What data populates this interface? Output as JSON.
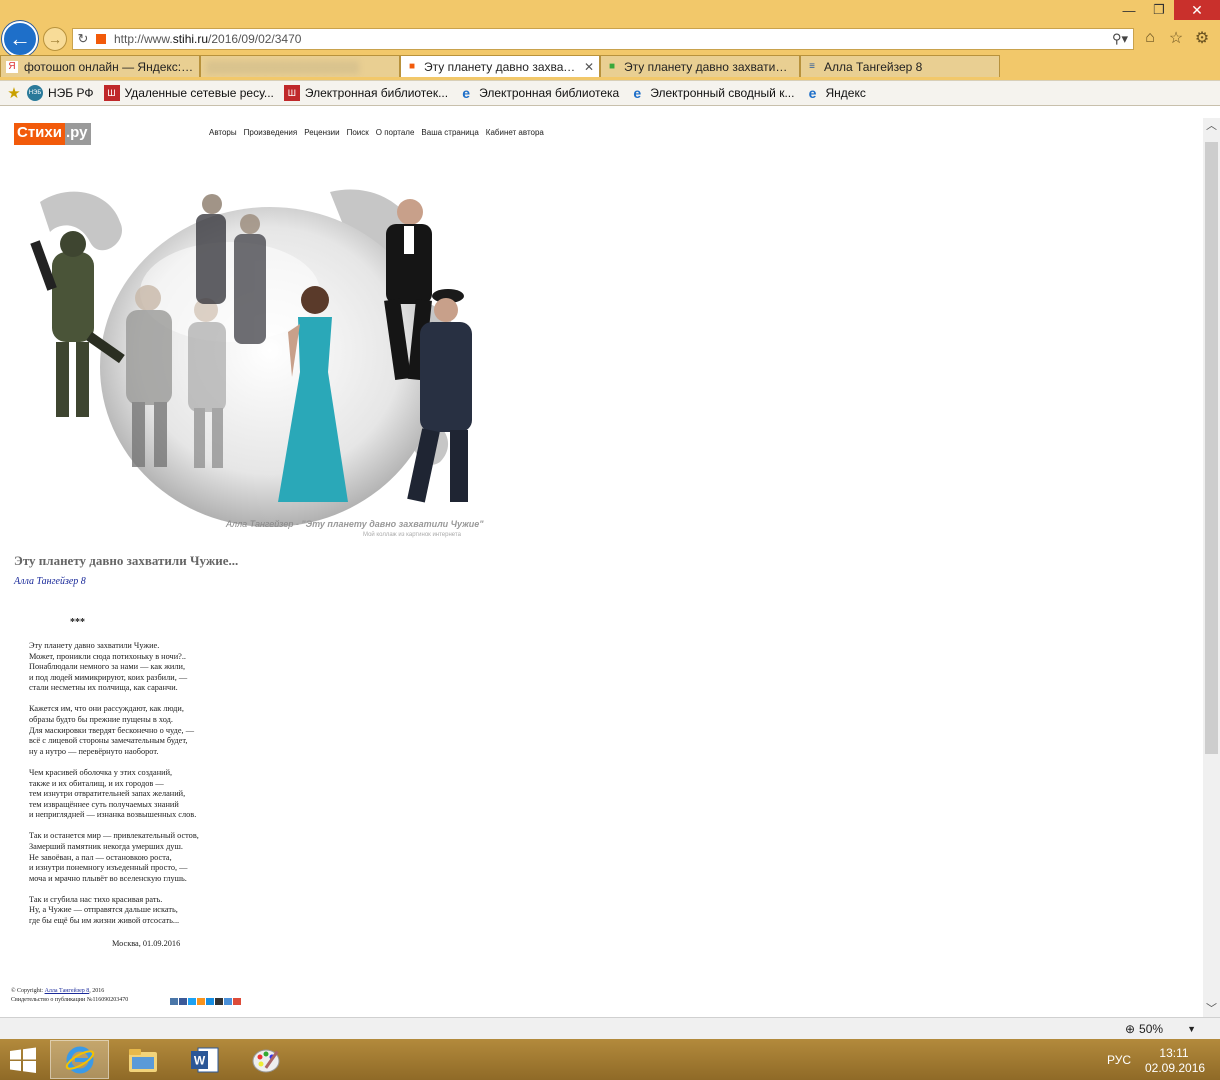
{
  "browser": {
    "window_controls": {
      "minimize": "—",
      "restore": "❐",
      "close": "✕"
    },
    "url_prefix": "http://www.",
    "url_domain": "stihi.ru",
    "url_path": "/2016/09/02/3470",
    "tabs": [
      {
        "label": "фотошоп онлайн — Яндекс: ...",
        "favicon": "Я",
        "favicon_color": "#d33"
      },
      {
        "label": "",
        "favicon": "",
        "blurred": true
      },
      {
        "label": "Эту планету давно захвати...",
        "favicon": "■",
        "favicon_color": "#f25a0a",
        "active": true,
        "close": "✕"
      },
      {
        "label": "Эту планету давно захватили.....",
        "favicon": "■",
        "favicon_color": "#3aa83a"
      },
      {
        "label": "Алла Тангейзер 8",
        "favicon": "≡",
        "favicon_color": "#2a5a9a"
      }
    ],
    "favorites": [
      {
        "label": "НЭБ РФ",
        "icon": "нэб"
      },
      {
        "label": "Удаленные сетевые ресу...",
        "icon": "Ш"
      },
      {
        "label": "Электронная библиотек...",
        "icon": "Ш"
      },
      {
        "label": "Электронная библиотека",
        "icon": "e"
      },
      {
        "label": "Электронный сводный к...",
        "icon": "e"
      },
      {
        "label": "Яндекс",
        "icon": "e"
      }
    ],
    "zoom": "50%"
  },
  "site": {
    "logo_part1": "Стихи",
    "logo_part2": ".ру",
    "nav": [
      "Авторы",
      "Произведения",
      "Рецензии",
      "Поиск",
      "О портале",
      "Ваша страница",
      "Кабинет автора"
    ]
  },
  "hero": {
    "caption_author": "Алла Тангейзер - ",
    "caption_title": "\"Эту планету давно захватили Чужие\"",
    "subcaption": "Мой коллаж из картинок интернета"
  },
  "poem": {
    "title": "Эту планету давно захватили Чужие...",
    "author": "Алла Тангейзер 8",
    "stars": "***",
    "stanzas": [
      [
        "Эту планету давно захватили Чужие.",
        "Может, проникли сюда потихоньку в ночи?..",
        "Понаблюдали немного за нами — как жили,",
        "и под людей мимикрируют, коих разбили, —",
        "стали несметны их полчища, как саранчи."
      ],
      [
        "Кажется им, что они рассуждают, как люди,",
        "образы будто бы прежние пущены в ход.",
        "Для маскировки твердят бесконечно о чуде, —",
        "всё с лицевой стороны замечательным будет,",
        "ну а нутро — перевёрнуто наоборот."
      ],
      [
        "Чем красивей оболочка у этих созданий,",
        "также и их обиталищ, и их городов —",
        "тем изнутри отвратительней запах желаний,",
        "тем извращённее суть получаемых знаний",
        " и неприглядней — изнанка возвышенных слов."
      ],
      [
        "Так и останется мир — привлекательный остов,",
        "Замерший памятник некогда умерших душ.",
        "Не завоёван, а пал — остановкою роста,",
        "и изнутри понемногу изъеденный просто, —",
        "моча и мрачно плывёт во вселенскую глушь."
      ],
      [
        "Так и сгубила нас тихо красивая рать.",
        "Ну, а Чужие — отправятся дальше искать,",
        "где бы ещё бы им жизни живой отсосать..."
      ]
    ],
    "place_date": "Москва, 01.09.2016"
  },
  "footer": {
    "copyright_prefix": "© Copyright: ",
    "copyright_author": "Алла Тангейзер 8",
    "copyright_year": ", 2016",
    "certificate": "Свидетельство о публикации №116090203470",
    "share_colors": [
      "#4a76a8",
      "#3b5998",
      "#1da1f2",
      "#f7931e",
      "#168de2",
      "#333",
      "#4a90d9",
      "#dd4b39"
    ]
  },
  "taskbar": {
    "lang": "РУС",
    "time": "13:11",
    "date": "02.09.2016"
  }
}
